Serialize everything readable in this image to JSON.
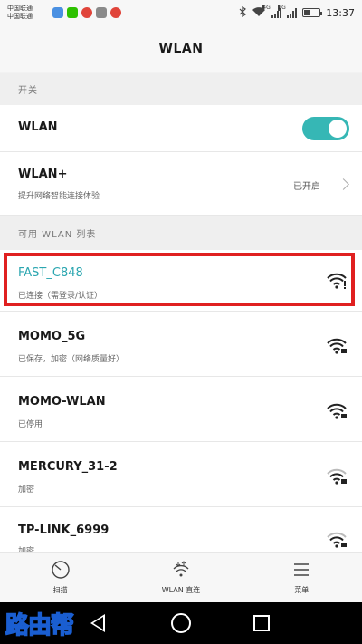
{
  "status_bar": {
    "carrier_1": "中国联通",
    "carrier_2": "中国联通",
    "time": "13:37",
    "net_1": "4G",
    "net_2": "2G",
    "battery_level": 0.45
  },
  "title": "WLAN",
  "switch_section": {
    "header": "开关",
    "wlan_label": "WLAN",
    "wlan_on": true,
    "wlan_plus_label": "WLAN+",
    "wlan_plus_sub": "提升网络智能连接体验",
    "wlan_plus_status": "已开启"
  },
  "networks_section": {
    "header": "可用 WLAN 列表",
    "networks": [
      {
        "name": "FAST_C848",
        "status": "已连接（需登录/认证）",
        "connected": true
      },
      {
        "name": "MOMO_5G",
        "status": "已保存，加密（网络质量好）",
        "connected": false
      },
      {
        "name": "MOMO-WLAN",
        "status": "已停用",
        "connected": false
      },
      {
        "name": "MERCURY_31-2",
        "status": "加密",
        "connected": false
      },
      {
        "name": "TP-LINK_6999",
        "status": "加密",
        "connected": false
      }
    ]
  },
  "toolbar": {
    "scan_label": "扫描",
    "direct_label": "WLAN 直连",
    "menu_label": "菜单"
  },
  "watermark": "路由帮",
  "colors": {
    "accent": "#36b7b5",
    "connected_text": "#2ba6b0",
    "highlight": "#e02020"
  }
}
